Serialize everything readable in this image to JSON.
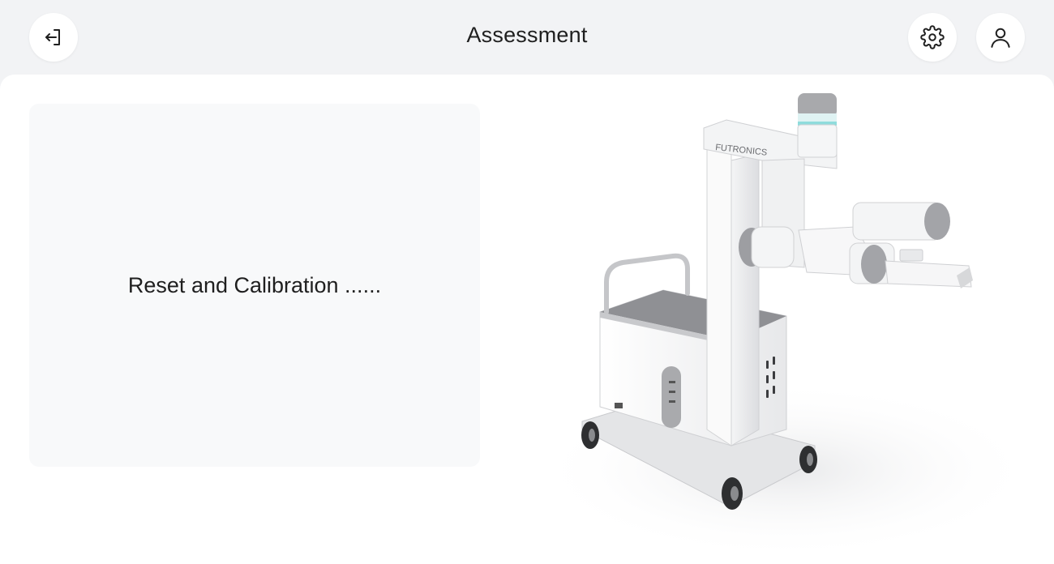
{
  "header": {
    "title": "Assessment",
    "icons": {
      "exit": "logout-icon",
      "settings": "gear-icon",
      "profile": "user-icon"
    }
  },
  "status": {
    "message": "Reset and Calibration ......"
  },
  "device": {
    "brand": "FUTRONICS"
  },
  "colors": {
    "background": "#f2f3f5",
    "surface": "#ffffff",
    "card": "#f8f9fa",
    "text": "#1f1f1f"
  }
}
